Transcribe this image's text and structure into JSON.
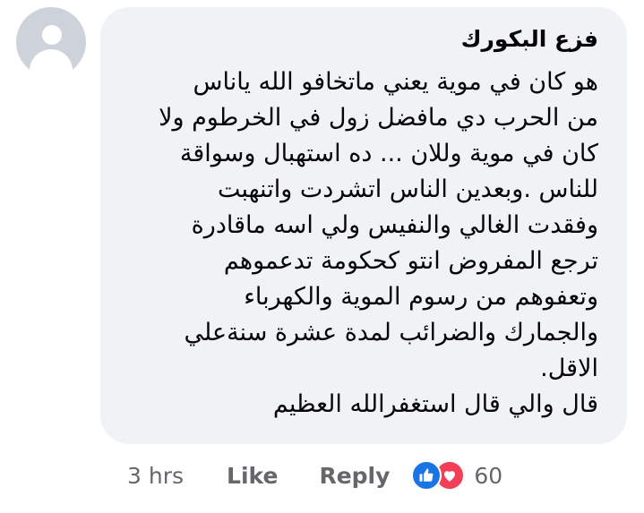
{
  "comment": {
    "author": "فزع البكورك",
    "lines": [
      "هو كان في موية يعني ماتخافو الله ياناس",
      "من الحرب دي مافضل زول في الخرطوم ولا",
      "كان في موية  وللان ...  ده استهبال وسواقة",
      "للناس .وبعدين الناس اتشردت واتنهبت",
      "وفقدت الغالي والنفيس ولي اسه ماقادرة",
      "ترجع المفروض انتو كحكومة تدعموهم",
      "وتعفوهم من رسوم الموية والكهرباء",
      "والجمارك والضرائب لمدة عشرة سنةعلي",
      "الاقل.",
      "قال والي قال استغفرالله العظيم"
    ]
  },
  "actions": {
    "time": "3 hrs",
    "like_label": "Like",
    "reply_label": "Reply",
    "reaction_count": "60"
  },
  "icons": {
    "avatar": "default-avatar-icon",
    "like_reaction": "thumbs-up-icon",
    "love_reaction": "heart-icon"
  },
  "colors": {
    "bubble": "#f0f2f5",
    "text": "#050505",
    "secondary_text": "#65676b",
    "like_blue": "#1b74e4",
    "love_red": "#f33e58"
  }
}
